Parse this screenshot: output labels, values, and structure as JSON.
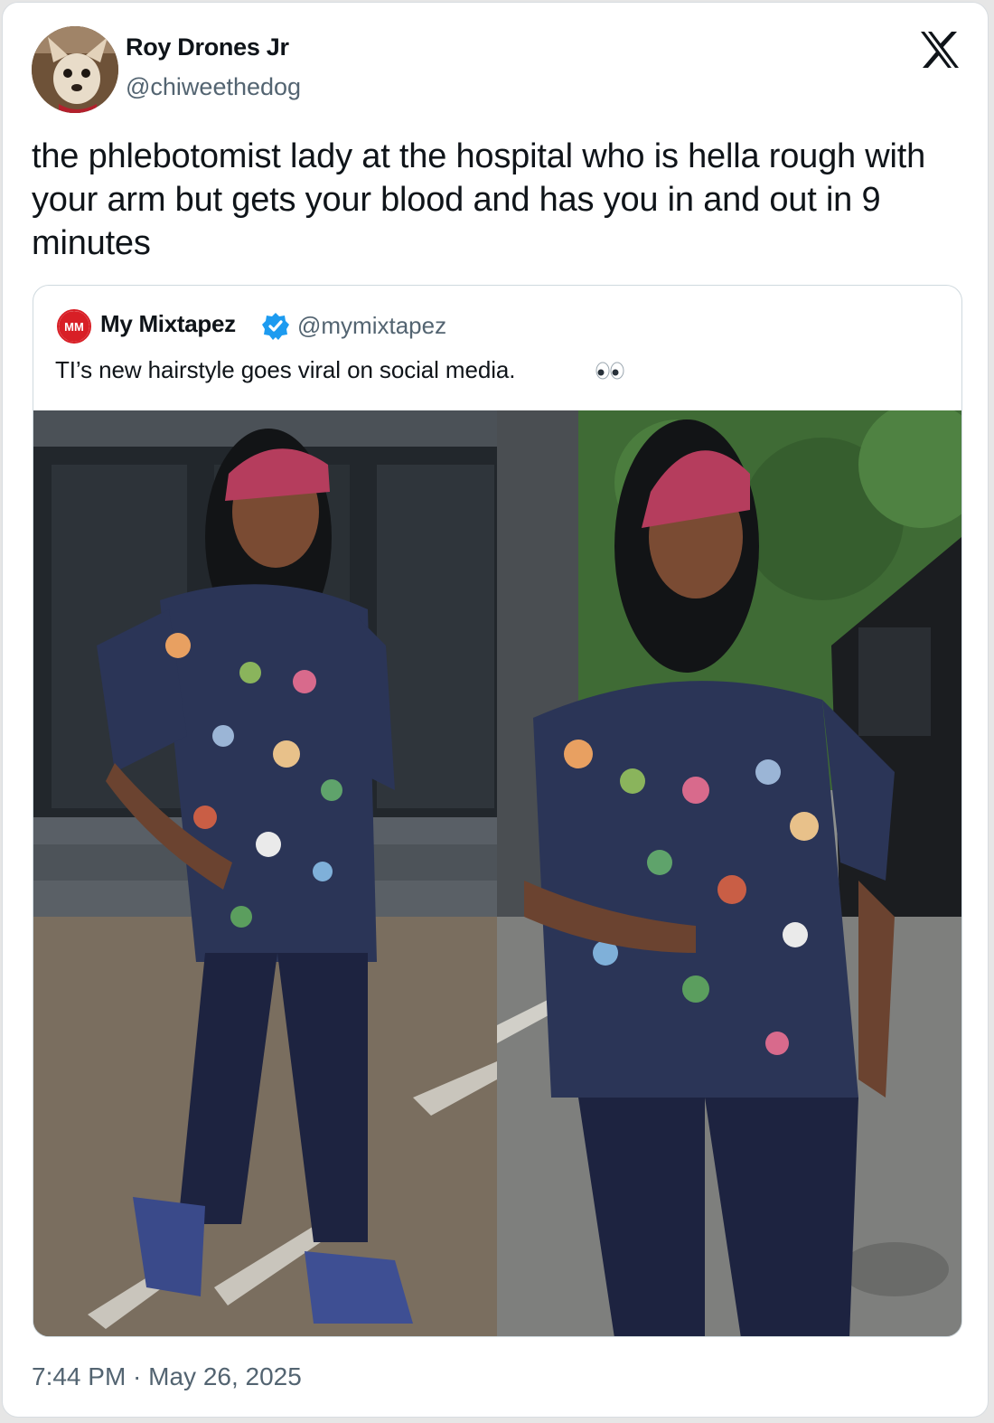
{
  "tweet": {
    "author_name": "Roy Drones Jr",
    "author_handle": "@chiweethedog",
    "avatar_icon": "chihuahua-avatar",
    "brand_icon": "x-logo-icon",
    "text": "the phlebotomist lady at the hospital who is hella rough with your arm but gets your blood and has you in and out in 9 minutes",
    "timestamp": "7:44 PM · May 26, 2025"
  },
  "quote": {
    "author_name": "My Mixtapez",
    "author_handle": "@mymixtapez",
    "logo_text": "MM",
    "verified": true,
    "verified_icon": "verified-badge-icon",
    "text": "TI’s new hairstyle goes viral on social media.",
    "emoji": "eyes-emoji",
    "media": [
      {
        "name": "photo-left",
        "description_icon": "man-walking-photo"
      },
      {
        "name": "photo-right",
        "description_icon": "man-standing-photo"
      }
    ]
  },
  "colors": {
    "text_primary": "#0f1419",
    "text_secondary": "#536471",
    "border": "#cfd9de",
    "verified_blue": "#1d9bf0",
    "brand_red": "#d81f26"
  }
}
